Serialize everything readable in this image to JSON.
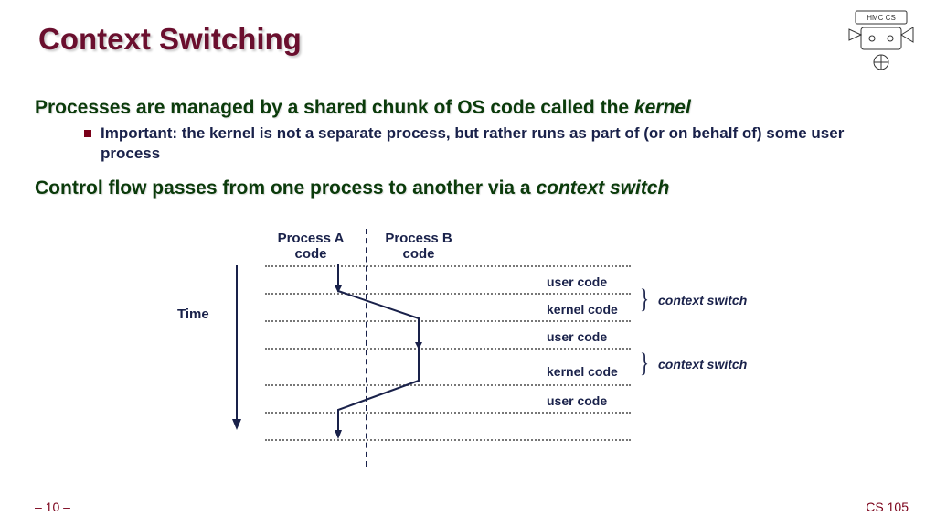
{
  "title": "Context Switching",
  "point1_a": "Processes are managed by a shared chunk of OS code called the ",
  "point1_b": "kernel",
  "sub1": "Important: the kernel is not a separate process, but rather runs as part of (or on behalf of) some user process",
  "point2_a": "Control flow passes from one process to another via a ",
  "point2_b": "context switch",
  "diagram": {
    "time": "Time",
    "procA": "Process A code",
    "procB": "Process B code",
    "rows": {
      "r1": "user code",
      "r2": "kernel code",
      "r3": "user code",
      "r4": "kernel code",
      "r5": "user code"
    },
    "cs": "context switch"
  },
  "footer": {
    "page": "– 10 –",
    "course": "CS 105"
  },
  "logo_text": "HMC  CS"
}
